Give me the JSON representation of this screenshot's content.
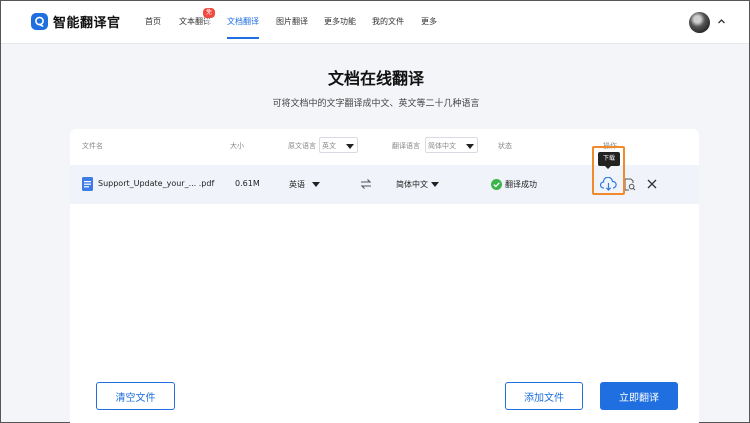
{
  "app": {
    "name": "智能翻译官"
  },
  "nav": {
    "items": [
      {
        "label": "首页"
      },
      {
        "label": "文本翻译",
        "badge": "免费"
      },
      {
        "label": "文档翻译",
        "active": true
      },
      {
        "label": "图片翻译"
      },
      {
        "label": "更多功能"
      },
      {
        "label": "我的文件"
      },
      {
        "label": "更多"
      }
    ]
  },
  "page": {
    "title": "文档在线翻译",
    "subtitle": "可将文档中的文字翻译成中文、英文等二十几种语言"
  },
  "table": {
    "headers": {
      "filename": "文件名",
      "size": "大小",
      "source_lang": "原文语言",
      "source_lang_select": "英文",
      "target_lang": "翻译语言",
      "target_lang_select": "简体中文",
      "status": "状态",
      "actions": "操作"
    },
    "rows": [
      {
        "filename": "Support_Update_your_... .pdf",
        "size": "0.61M",
        "source_lang": "英语",
        "target_lang": "简体中文",
        "status": "翻译成功"
      }
    ]
  },
  "tooltip": {
    "download": "下载"
  },
  "buttons": {
    "clear": "清空文件",
    "add": "添加文件",
    "translate": "立即翻译"
  },
  "colors": {
    "primary": "#1f6fe0",
    "success": "#3bb54a",
    "highlight": "#f08a2b",
    "badge": "#f04a3e"
  },
  "icons": {
    "logo": "app-logo-icon",
    "file": "document-file-icon",
    "swap": "swap-arrows-icon",
    "success": "check-circle-icon",
    "download": "cloud-download-icon",
    "preview": "file-search-icon",
    "delete": "close-icon",
    "chevron": "chevron-up-icon"
  }
}
